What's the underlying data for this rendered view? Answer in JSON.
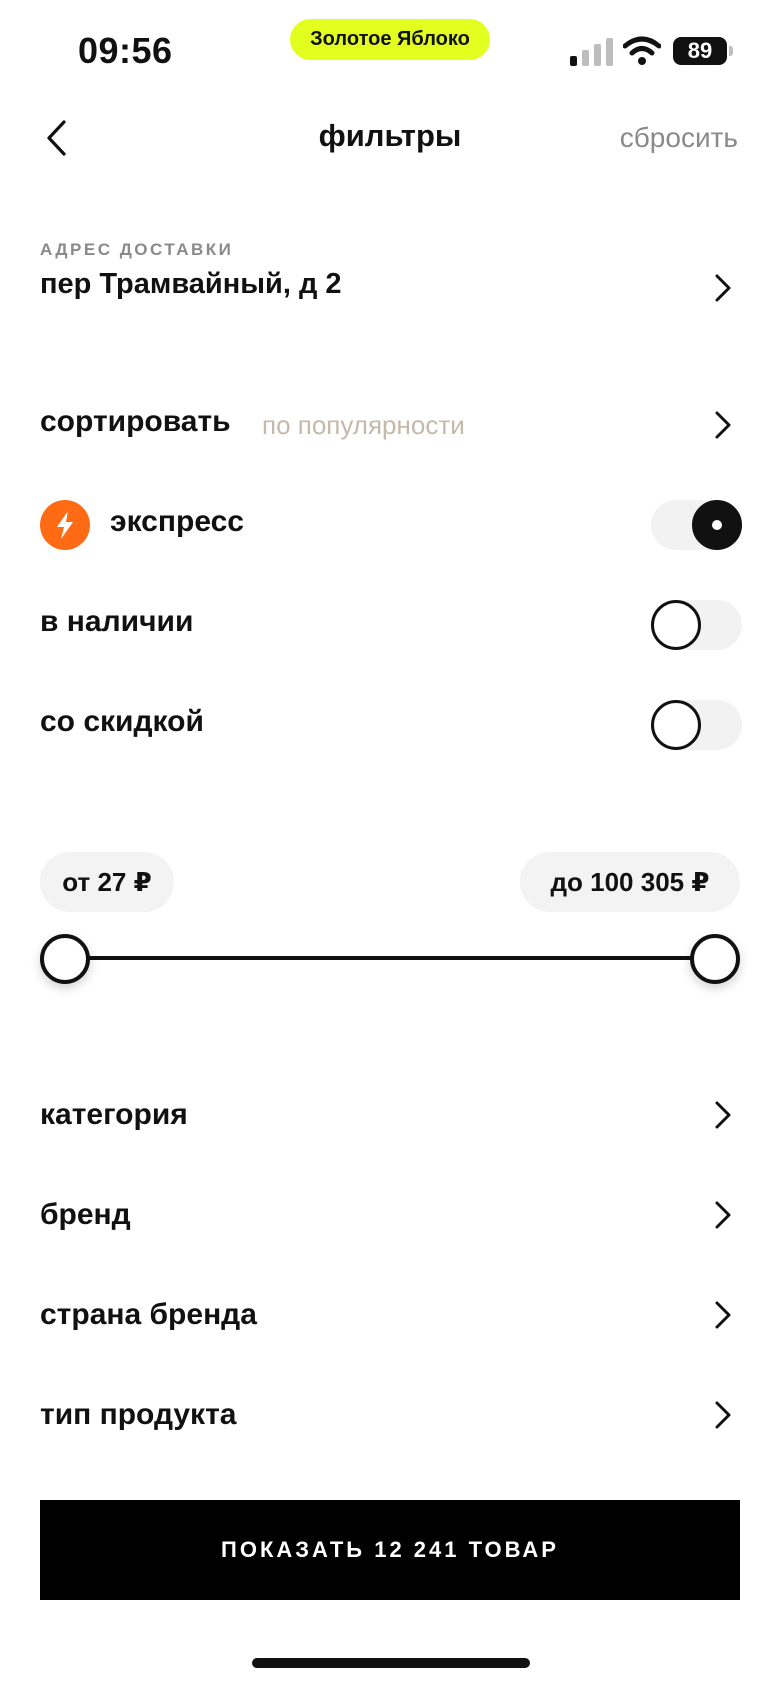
{
  "status_bar": {
    "time": "09:56",
    "island_label": "Золотое Яблоко",
    "battery": "89"
  },
  "header": {
    "title": "фильтры",
    "reset_label": "сбросить"
  },
  "address": {
    "caption": "АДРЕС ДОСТАВКИ",
    "value": "пер Трамвайный, д 2"
  },
  "sort": {
    "label": "сортировать",
    "value": "по популярности"
  },
  "toggles": [
    {
      "label": "экспресс",
      "on": true
    },
    {
      "label": "в наличии",
      "on": false
    },
    {
      "label": "со скидкой",
      "on": false
    }
  ],
  "price": {
    "min_label": "от 27 ₽",
    "max_label": "до 100 305 ₽"
  },
  "filters": [
    {
      "label": "категория"
    },
    {
      "label": "бренд"
    },
    {
      "label": "страна бренда"
    },
    {
      "label": "тип продукта"
    }
  ],
  "show_button": {
    "label": "ПОКАЗАТЬ 12 241 ТОВАР"
  },
  "colors": {
    "accent_express": "#ff6a14",
    "island": "#e3ff1f",
    "sort_value": "#c4b9ab"
  }
}
